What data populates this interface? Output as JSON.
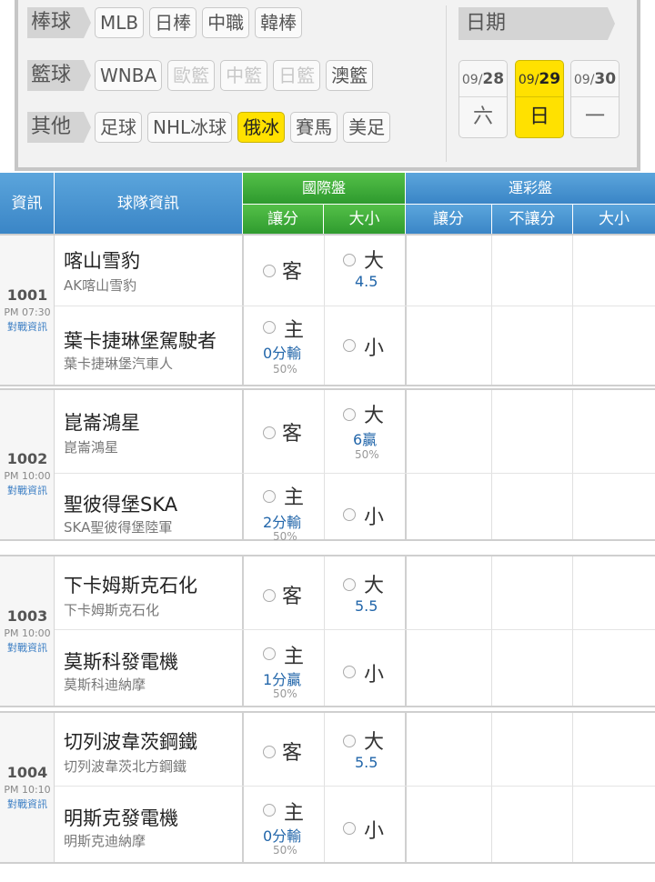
{
  "filter": {
    "rows": [
      {
        "tag": "棒球",
        "buttons": [
          {
            "label": "MLB",
            "state": "normal"
          },
          {
            "label": "日棒",
            "state": "normal"
          },
          {
            "label": "中職",
            "state": "normal"
          },
          {
            "label": "韓棒",
            "state": "normal"
          }
        ]
      },
      {
        "tag": "籃球",
        "buttons": [
          {
            "label": "WNBA",
            "state": "normal"
          },
          {
            "label": "歐籃",
            "state": "disabled"
          },
          {
            "label": "中籃",
            "state": "disabled"
          },
          {
            "label": "日籃",
            "state": "disabled"
          },
          {
            "label": "澳籃",
            "state": "normal"
          }
        ]
      },
      {
        "tag": "其他",
        "buttons": [
          {
            "label": "足球",
            "state": "normal"
          },
          {
            "label": "NHL冰球",
            "state": "normal"
          },
          {
            "label": "俄冰",
            "state": "active"
          },
          {
            "label": "賽馬",
            "state": "normal"
          },
          {
            "label": "美足",
            "state": "normal"
          }
        ]
      }
    ],
    "date_label": "日期",
    "dates": [
      {
        "month": "09/",
        "day": "28",
        "weekday": "六",
        "active": false
      },
      {
        "month": "09/",
        "day": "29",
        "weekday": "日",
        "active": true
      },
      {
        "month": "09/",
        "day": "30",
        "weekday": "一",
        "active": false
      }
    ]
  },
  "table": {
    "headers": {
      "info": "資訊",
      "team": "球隊資訊",
      "intl": "國際盤",
      "intl_spread": "讓分",
      "intl_total": "大小",
      "lottery": "運彩盤",
      "lot_spread": "讓分",
      "lot_nospread": "不讓分",
      "lot_total": "大小"
    },
    "link_label": "對戰資訊",
    "games": [
      {
        "id": "1001",
        "time": "PM 07:30",
        "away": {
          "name": "喀山雪豹",
          "sub": "AK喀山雪豹",
          "spread": "客",
          "total": "大",
          "total_line": "4.5",
          "total_pct": ""
        },
        "home": {
          "name": "葉卡捷琳堡駕駛者",
          "sub": "葉卡捷琳堡汽車人",
          "spread": "主",
          "spread_line": "0分輸",
          "spread_pct": "50%",
          "total": "小"
        }
      },
      {
        "id": "1002",
        "time": "PM 10:00",
        "away": {
          "name": "崑崙鴻星",
          "sub": "崑崙鴻星",
          "spread": "客",
          "total": "大",
          "total_line": "6贏",
          "total_pct": "50%"
        },
        "home": {
          "name": "聖彼得堡SKA",
          "sub": "SKA聖彼得堡陸軍",
          "spread": "主",
          "spread_line": "2分輸",
          "spread_pct": "50%",
          "total": "小"
        }
      },
      {
        "id": "1003",
        "time": "PM 10:00",
        "away": {
          "name": "下卡姆斯克石化",
          "sub": "下卡姆斯克石化",
          "spread": "客",
          "total": "大",
          "total_line": "5.5",
          "total_pct": ""
        },
        "home": {
          "name": "莫斯科發電機",
          "sub": "莫斯科迪納摩",
          "spread": "主",
          "spread_line": "1分贏",
          "spread_pct": "50%",
          "total": "小"
        }
      },
      {
        "id": "1004",
        "time": "PM 10:10",
        "away": {
          "name": "切列波韋茨鋼鐵",
          "sub": "切列波韋茨北方鋼鐵",
          "spread": "客",
          "total": "大",
          "total_line": "5.5",
          "total_pct": ""
        },
        "home": {
          "name": "明斯克發電機",
          "sub": "明斯克迪納摩",
          "spread": "主",
          "spread_line": "0分輸",
          "spread_pct": "50%",
          "total": "小"
        }
      }
    ]
  },
  "colors": {
    "active": "#ffe100",
    "header_blue": "#3a85c6",
    "header_green": "#2e9a2e",
    "odds_blue": "#2266aa"
  }
}
